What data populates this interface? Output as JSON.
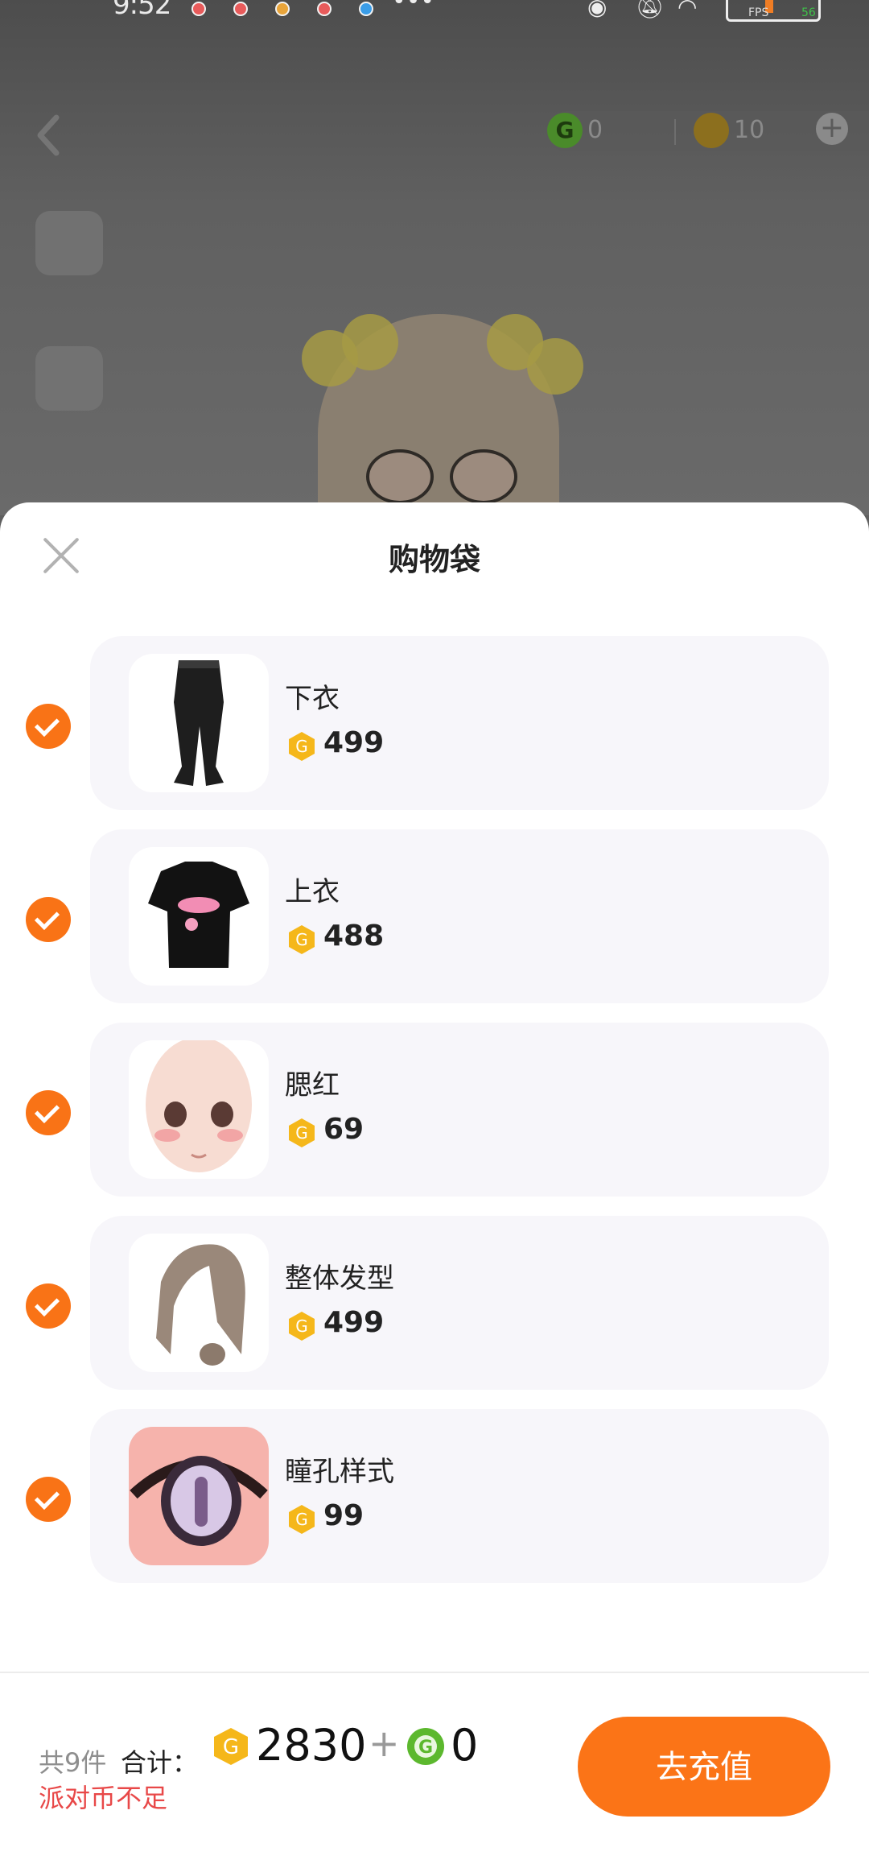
{
  "status_bar": {
    "time": "9:52",
    "fps_label": "FPS",
    "fps_value": "56"
  },
  "background": {
    "currency_g_value": "0",
    "currency_party_value": "10"
  },
  "sheet": {
    "title": "购物袋",
    "items": [
      {
        "name": "下衣",
        "price": "499",
        "thumb": "pants"
      },
      {
        "name": "上衣",
        "price": "488",
        "thumb": "tshirt"
      },
      {
        "name": "腮红",
        "price": "69",
        "thumb": "face"
      },
      {
        "name": "整体发型",
        "price": "499",
        "thumb": "hair"
      },
      {
        "name": "瞳孔样式",
        "price": "99",
        "thumb": "eye"
      }
    ]
  },
  "footer": {
    "count": "共9件",
    "total_label": "合计：",
    "total_party_coins": "2830",
    "plus": "+",
    "total_g_coins": "0",
    "warning": "派对币不足",
    "recharge_button": "去充值"
  },
  "colors": {
    "accent": "#fb7417",
    "warning": "#e84848",
    "coin": "#f5b71a",
    "g_coin": "#5cb82e"
  }
}
